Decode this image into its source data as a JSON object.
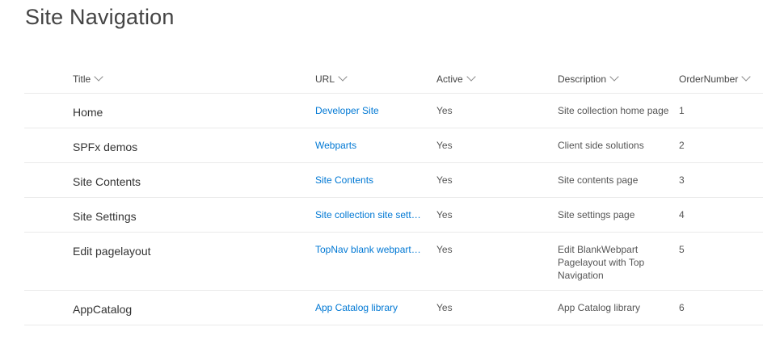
{
  "page_title": "Site Navigation",
  "columns": [
    "Title",
    "URL",
    "Active",
    "Description",
    "OrderNumber"
  ],
  "rows": [
    {
      "title": "Home",
      "url": "Developer Site",
      "active": "Yes",
      "description": "Site collection home page",
      "order": "1"
    },
    {
      "title": "SPFx demos",
      "url": "Webparts",
      "active": "Yes",
      "description": "Client side solutions",
      "order": "2"
    },
    {
      "title": "Site Contents",
      "url": "Site Contents",
      "active": "Yes",
      "description": "Site contents page",
      "order": "3"
    },
    {
      "title": "Site Settings",
      "url": "Site collection site settings",
      "active": "Yes",
      "description": "Site settings page",
      "order": "4"
    },
    {
      "title": "Edit pagelayout",
      "url": "TopNav blank webpart pagelayout",
      "active": "Yes",
      "description": "Edit BlankWebpart Pagelayout with Top Navigation",
      "order": "5"
    },
    {
      "title": "AppCatalog",
      "url": "App Catalog library",
      "active": "Yes",
      "description": "App Catalog library",
      "order": "6"
    }
  ],
  "colors": {
    "link": "#0078d4",
    "divider": "#eaeaea"
  }
}
